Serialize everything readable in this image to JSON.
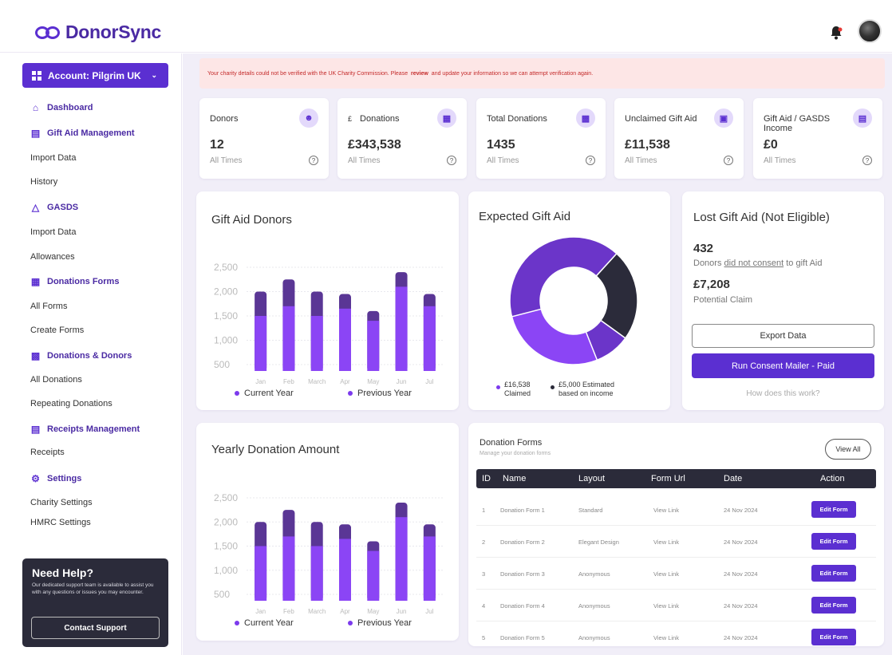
{
  "app": {
    "name": "DonorSync"
  },
  "sidebar": {
    "account_label": "Account: Pilgrim UK",
    "items": [
      {
        "label": "Dashboard",
        "section": true,
        "icon": "home-icon"
      },
      {
        "label": "Gift Aid Management",
        "section": true,
        "icon": "document-icon"
      },
      {
        "label": "Import Data",
        "section": false
      },
      {
        "label": "History",
        "section": false
      },
      {
        "label": "GASDS",
        "section": true,
        "icon": "flask-icon"
      },
      {
        "label": "Import Data",
        "section": false
      },
      {
        "label": "Allowances",
        "section": false
      },
      {
        "label": "Donations Forms",
        "section": true,
        "icon": "form-icon"
      },
      {
        "label": "All Forms",
        "section": false
      },
      {
        "label": "Create Forms",
        "section": false
      },
      {
        "label": "Donations & Donors",
        "section": true,
        "icon": "building-icon"
      },
      {
        "label": "All Donations",
        "section": false
      },
      {
        "label": "Repeating Donations",
        "section": false
      },
      {
        "label": "Receipts Management",
        "section": true,
        "icon": "receipt-icon"
      },
      {
        "label": "Receipts",
        "section": false
      },
      {
        "label": "Settings",
        "section": true,
        "icon": "gear-icon"
      },
      {
        "label": "Charity Settings",
        "section": false
      },
      {
        "label": "HMRC Settings",
        "section": false
      }
    ],
    "help": {
      "title": "Need Help?",
      "text": "Our dedicated support team is available to assist you with any questions or issues you may encounter.",
      "button": "Contact Support"
    }
  },
  "alert": {
    "before": "Your charity details could not be verified with the UK Charity Commission. Please",
    "link": "review",
    "after": "and update your information so we can attempt verification again."
  },
  "stats": [
    {
      "title": "Donors",
      "value": "12",
      "sub": "All Times",
      "icon": "people-icon"
    },
    {
      "title": "Donations",
      "prefix": "£",
      "value": "£343,538",
      "sub": "All Times",
      "icon": "calendar-icon"
    },
    {
      "title": "Total Donations",
      "value": "1435",
      "sub": "All Times",
      "icon": "bar-chart-icon"
    },
    {
      "title": "Unclaimed Gift Aid",
      "value": "£11,538",
      "sub": "All Times",
      "icon": "gift-icon"
    },
    {
      "title": "Gift Aid / GASDS Income",
      "value": "£0",
      "sub": "All Times",
      "icon": "document-icon"
    }
  ],
  "gift_aid_donors": {
    "title": "Gift Aid Donors",
    "legend": [
      "Current Year",
      "Previous Year"
    ]
  },
  "yearly_donation": {
    "title": "Yearly Donation Amount",
    "legend": [
      "Current Year",
      "Previous Year"
    ]
  },
  "expected_gift_aid": {
    "title": "Expected Gift Aid",
    "legend": [
      {
        "value": "£16,538",
        "label": "Claimed",
        "color": "#7c3aed"
      },
      {
        "value": "£5,000 Estimated",
        "label": "based on income",
        "color": "#2b2b3a"
      }
    ]
  },
  "lost_gift_aid": {
    "title": "Lost Gift Aid (Not Eligible)",
    "count": "432",
    "count_sub_before": "Donors",
    "count_sub_link": "did not consent",
    "count_sub_after": "to gift Aid",
    "amount": "£7,208",
    "amount_sub": "Potential Claim",
    "export_btn": "Export Data",
    "mailer_btn": "Run Consent Mailer - Paid",
    "how": "How does this work?"
  },
  "donation_forms": {
    "title": "Donation Forms",
    "subtitle": "Manage your donation forms",
    "view_all": "View All",
    "columns": [
      "ID",
      "Name",
      "Layout",
      "Form Url",
      "Date",
      "Action"
    ],
    "rows": [
      {
        "id": "1",
        "name": "Donation Form 1",
        "layout": "Standard",
        "url": "View Link",
        "date": "24 Nov 2024",
        "action": "Edit Form"
      },
      {
        "id": "2",
        "name": "Donation Form 2",
        "layout": "Elegant Design",
        "url": "View Link",
        "date": "24 Nov 2024",
        "action": "Edit Form"
      },
      {
        "id": "3",
        "name": "Donation Form 3",
        "layout": "Anonymous",
        "url": "View Link",
        "date": "24 Nov 2024",
        "action": "Edit Form"
      },
      {
        "id": "4",
        "name": "Donation Form 4",
        "layout": "Anonymous",
        "url": "View Link",
        "date": "24 Nov 2024",
        "action": "Edit Form"
      },
      {
        "id": "5",
        "name": "Donation Form 5",
        "layout": "Anonymous",
        "url": "View Link",
        "date": "24 Nov 2024",
        "action": "Edit Form"
      }
    ]
  },
  "chart_data": [
    {
      "type": "bar",
      "title": "Gift Aid Donors",
      "categories": [
        "Jan",
        "Feb",
        "March",
        "Apr",
        "May",
        "Jun",
        "Jul"
      ],
      "yticks": [
        "2,500",
        "2,000",
        "1,500",
        "1,000",
        "500"
      ],
      "series": [
        {
          "name": "Current Year",
          "values": [
            1500,
            1700,
            1500,
            1650,
            1400,
            2100,
            1700
          ],
          "color": "#8b45f5"
        },
        {
          "name": "Previous Year",
          "values": [
            2000,
            2250,
            2000,
            1950,
            1600,
            2400,
            1950
          ],
          "color": "#5a3695"
        }
      ]
    },
    {
      "type": "bar",
      "title": "Yearly Donation Amount",
      "categories": [
        "Jan",
        "Feb",
        "March",
        "Apr",
        "May",
        "Jun",
        "Jul"
      ],
      "yticks": [
        "2,500",
        "2,000",
        "1,500",
        "1,000",
        "500"
      ],
      "series": [
        {
          "name": "Current Year",
          "values": [
            1500,
            1700,
            1500,
            1650,
            1400,
            2100,
            1700
          ],
          "color": "#8b45f5"
        },
        {
          "name": "Previous Year",
          "values": [
            2000,
            2250,
            2000,
            1950,
            1600,
            2400,
            1950
          ],
          "color": "#5a3695"
        }
      ]
    },
    {
      "type": "pie",
      "title": "Expected Gift Aid",
      "slices": [
        {
          "label": "Claimed",
          "value": 16538,
          "color": "#8b45f5"
        },
        {
          "label": "Estimated based on income",
          "value": 5000,
          "color": "#2b2b3a"
        }
      ]
    }
  ]
}
